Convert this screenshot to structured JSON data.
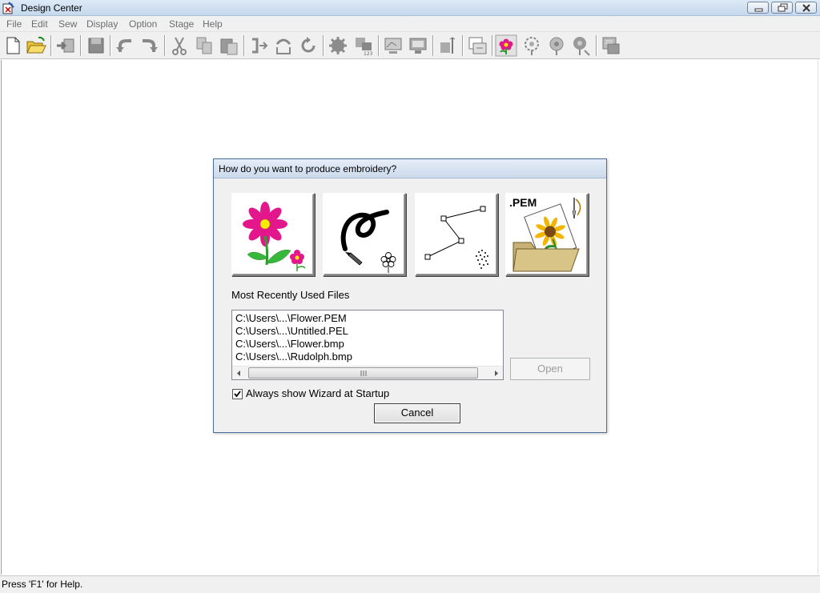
{
  "window": {
    "title": "Design Center"
  },
  "menu": [
    "File",
    "Edit",
    "Sew",
    "Display",
    "Option",
    "Stage",
    "Help"
  ],
  "toolbar": {
    "buttons": [
      "new-file",
      "open-file",
      "import",
      "save",
      "undo",
      "redo",
      "cut",
      "copy",
      "paste",
      "flip-horizontal",
      "flip-vertical",
      "rotate",
      "sew-settings",
      "stitch-order",
      "preview",
      "display",
      "stitch-simulator",
      "print-preview",
      "flower-stage",
      "stage-2",
      "stage-3",
      "stage-4",
      "transfer"
    ]
  },
  "dialog": {
    "title": "How do you want to produce embroidery?",
    "choices": [
      "image-to-outline",
      "freehand-drawing",
      "line-drawing",
      "open-pem-file"
    ],
    "pem_label": ".PEM",
    "mru_label": "Most Recently Used Files",
    "mru_files": [
      "C:\\Users\\...\\Flower.PEM",
      "C:\\Users\\...\\Untitled.PEL",
      "C:\\Users\\...\\Flower.bmp",
      "C:\\Users\\...\\Rudolph.bmp"
    ],
    "open_label": "Open",
    "checkbox_label": "Always show Wizard at Startup",
    "checkbox_checked": true,
    "cancel_label": "Cancel"
  },
  "status": {
    "text": "Press 'F1' for Help."
  }
}
